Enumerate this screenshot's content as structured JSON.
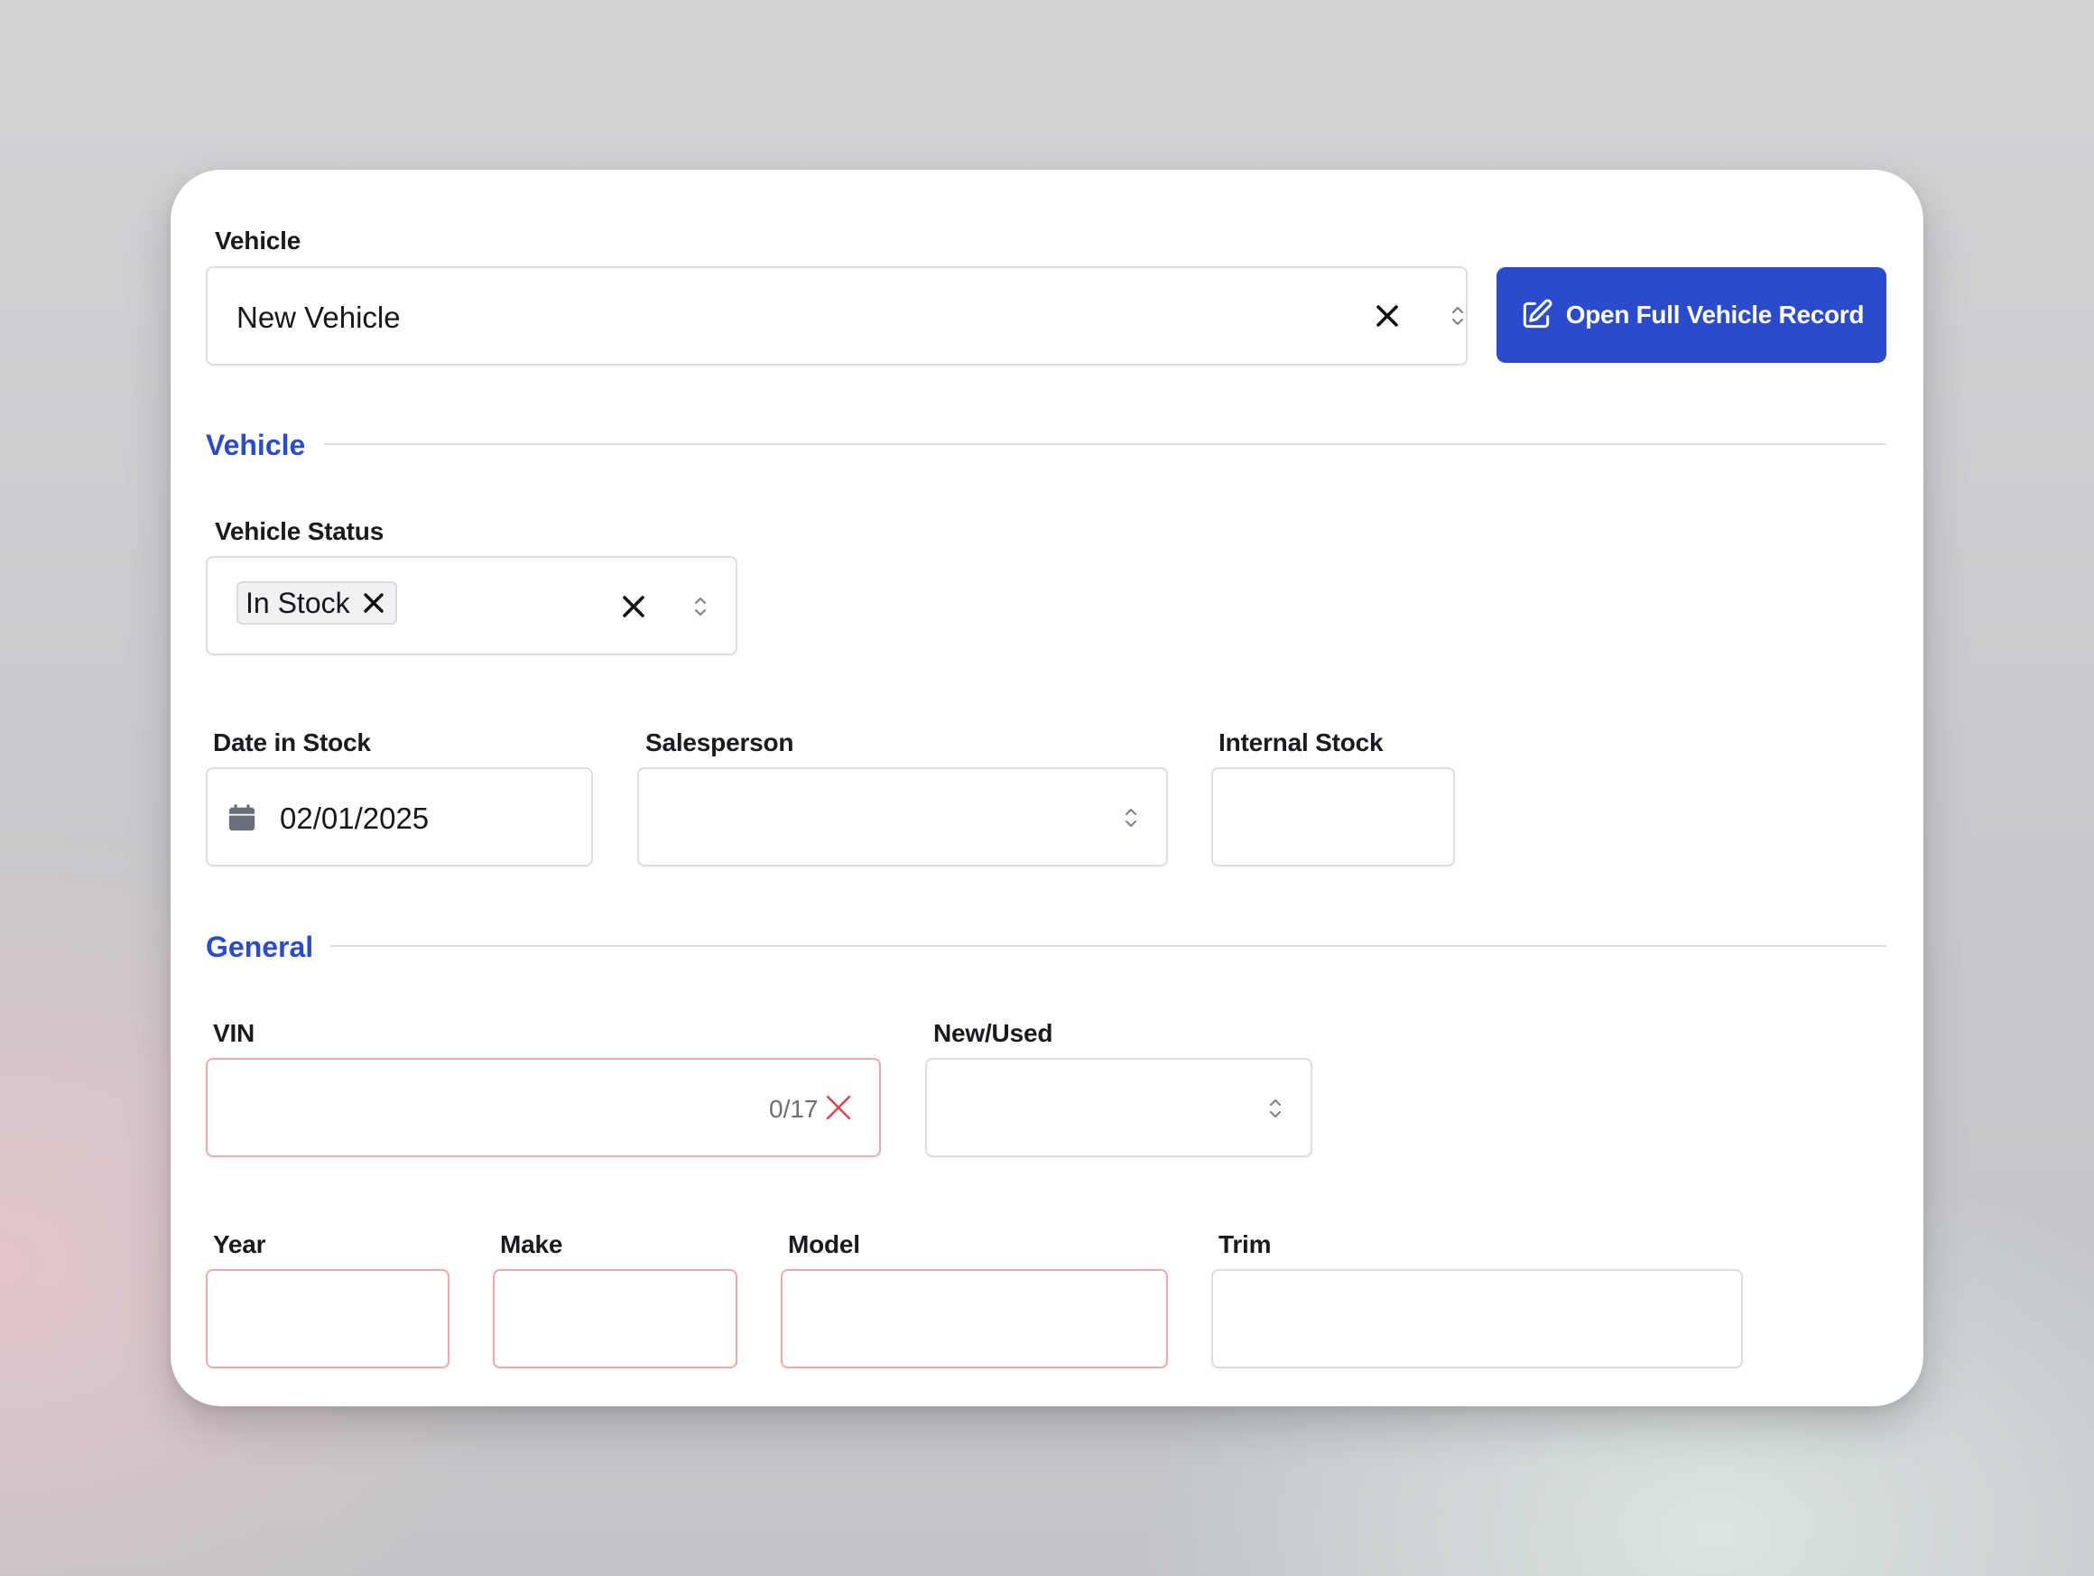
{
  "vehicle_select": {
    "label": "Vehicle",
    "value": "New Vehicle"
  },
  "open_record_button": {
    "label": "Open Full Vehicle Record"
  },
  "sections": {
    "vehicle": "Vehicle",
    "general": "General"
  },
  "vehicle_status": {
    "label": "Vehicle Status",
    "chip": "In Stock"
  },
  "date_in_stock": {
    "label": "Date in Stock",
    "value": "02/01/2025"
  },
  "salesperson": {
    "label": "Salesperson",
    "value": ""
  },
  "internal_stock": {
    "label": "Internal Stock",
    "value": ""
  },
  "vin": {
    "label": "VIN",
    "value": "",
    "counter": "0/17"
  },
  "new_used": {
    "label": "New/Used",
    "value": ""
  },
  "year": {
    "label": "Year",
    "value": ""
  },
  "make": {
    "label": "Make",
    "value": ""
  },
  "model": {
    "label": "Model",
    "value": ""
  },
  "trim": {
    "label": "Trim",
    "value": ""
  },
  "colors": {
    "accent": "#2a4ccc",
    "error_border": "#ecaaaa",
    "error_icon": "#e0474c"
  }
}
